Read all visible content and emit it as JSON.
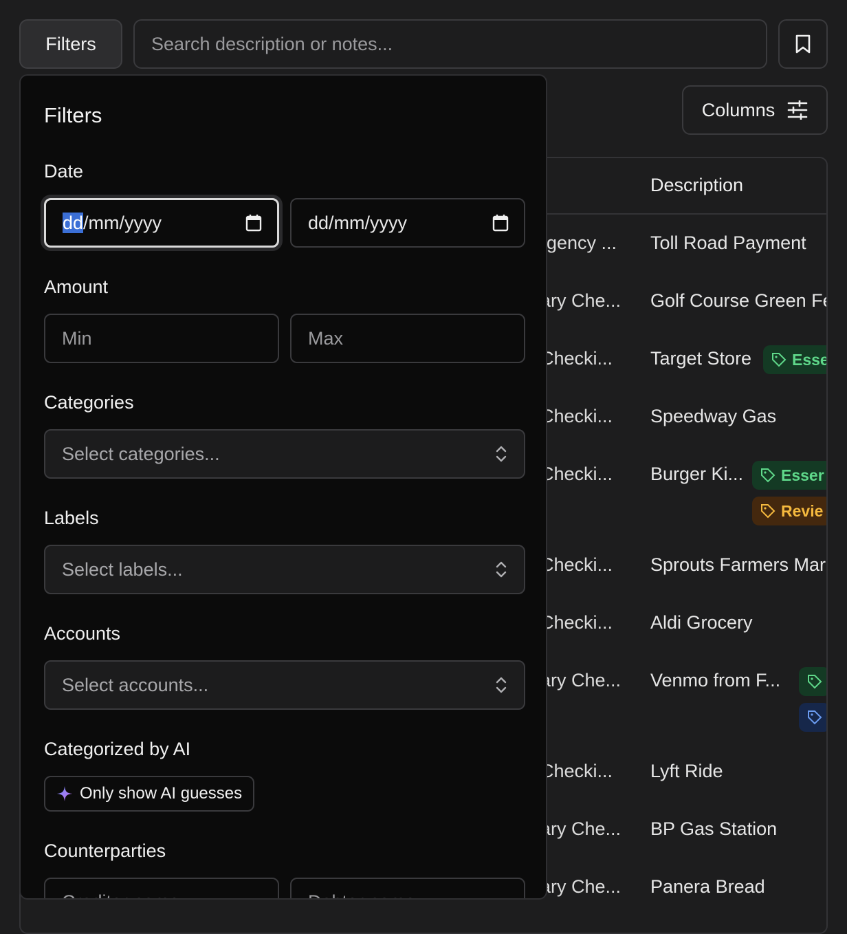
{
  "toolbar": {
    "filters_label": "Filters",
    "search_placeholder": "Search description or notes...",
    "columns_label": "Columns"
  },
  "table": {
    "description_header": "Description",
    "rows": [
      {
        "account": "rgency ...",
        "description": "Toll Road Payment",
        "tags": []
      },
      {
        "account": "ary Che...",
        "description": "Golf Course Green Fe",
        "tags": []
      },
      {
        "account": "Checki...",
        "description": "Target Store",
        "tags": [
          {
            "label": "Esse",
            "color": "green"
          }
        ]
      },
      {
        "account": "Checki...",
        "description": "Speedway Gas",
        "tags": []
      },
      {
        "account": "Checki...",
        "description": "Burger Ki...",
        "tags": [
          {
            "label": "Esser",
            "color": "green"
          },
          {
            "label": "Revie",
            "color": "orange"
          }
        ]
      },
      {
        "account": "Checki...",
        "description": "Sprouts Farmers Mar",
        "tags": []
      },
      {
        "account": "Checki...",
        "description": "Aldi Grocery",
        "tags": []
      },
      {
        "account": "ary Che...",
        "description": "Venmo from F...",
        "tags": [
          {
            "label": "",
            "color": "green"
          },
          {
            "label": "",
            "color": "blue"
          }
        ]
      },
      {
        "account": "Checki...",
        "description": "Lyft Ride",
        "tags": []
      },
      {
        "account": "ary Che...",
        "description": "BP Gas Station",
        "tags": []
      },
      {
        "account": "ary Che...",
        "description": "Panera Bread",
        "tags": []
      }
    ]
  },
  "filters_panel": {
    "title": "Filters",
    "date": {
      "label": "Date",
      "from_selected_part": "dd",
      "from_rest": "/mm/yyyy",
      "to_value": "dd/mm/yyyy"
    },
    "amount": {
      "label": "Amount",
      "min_placeholder": "Min",
      "max_placeholder": "Max"
    },
    "categories": {
      "label": "Categories",
      "placeholder": "Select categories..."
    },
    "labels": {
      "label": "Labels",
      "placeholder": "Select labels..."
    },
    "accounts": {
      "label": "Accounts",
      "placeholder": "Select accounts..."
    },
    "ai": {
      "label": "Categorized by AI",
      "button_label": "Only show AI guesses"
    },
    "counterparties": {
      "label": "Counterparties",
      "creditor_placeholder": "Creditor name",
      "debtor_placeholder": "Debtor name"
    }
  },
  "colors": {
    "background": "#1d1d1e",
    "panel": "#0b0b0b",
    "tag_green": "#5fd88a",
    "tag_orange": "#f5b93e",
    "tag_blue": "#6a9bef",
    "focus_selection": "#3b6fd6"
  }
}
